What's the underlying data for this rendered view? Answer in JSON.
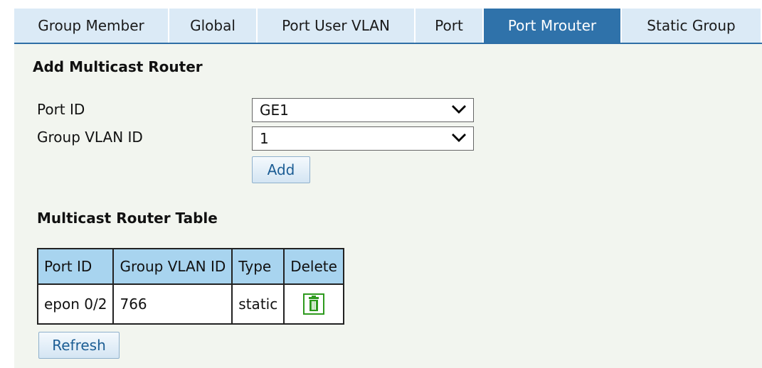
{
  "tabs": [
    {
      "label": "Group Member"
    },
    {
      "label": "Global"
    },
    {
      "label": "Port User VLAN"
    },
    {
      "label": "Port"
    },
    {
      "label": "Port Mrouter",
      "active": true
    },
    {
      "label": "Static Group"
    }
  ],
  "add_section": {
    "title": "Add Multicast Router",
    "port_id_label": "Port ID",
    "port_id_value": "GE1",
    "group_vlan_label": "Group VLAN ID",
    "group_vlan_value": "1",
    "add_button": "Add"
  },
  "table_section": {
    "title": "Multicast Router Table",
    "headers": [
      "Port ID",
      "Group VLAN ID",
      "Type",
      "Delete"
    ],
    "rows": [
      {
        "port_id": "epon 0/2",
        "group_vlan_id": "766",
        "type": "static",
        "delete_icon": "trash-icon"
      }
    ],
    "refresh_button": "Refresh"
  },
  "colors": {
    "active_tab": "#2f72aa",
    "header_bg": "#a8d4ef",
    "panel_bg": "#f2f5ef",
    "trash_green": "#2e9a1e"
  }
}
